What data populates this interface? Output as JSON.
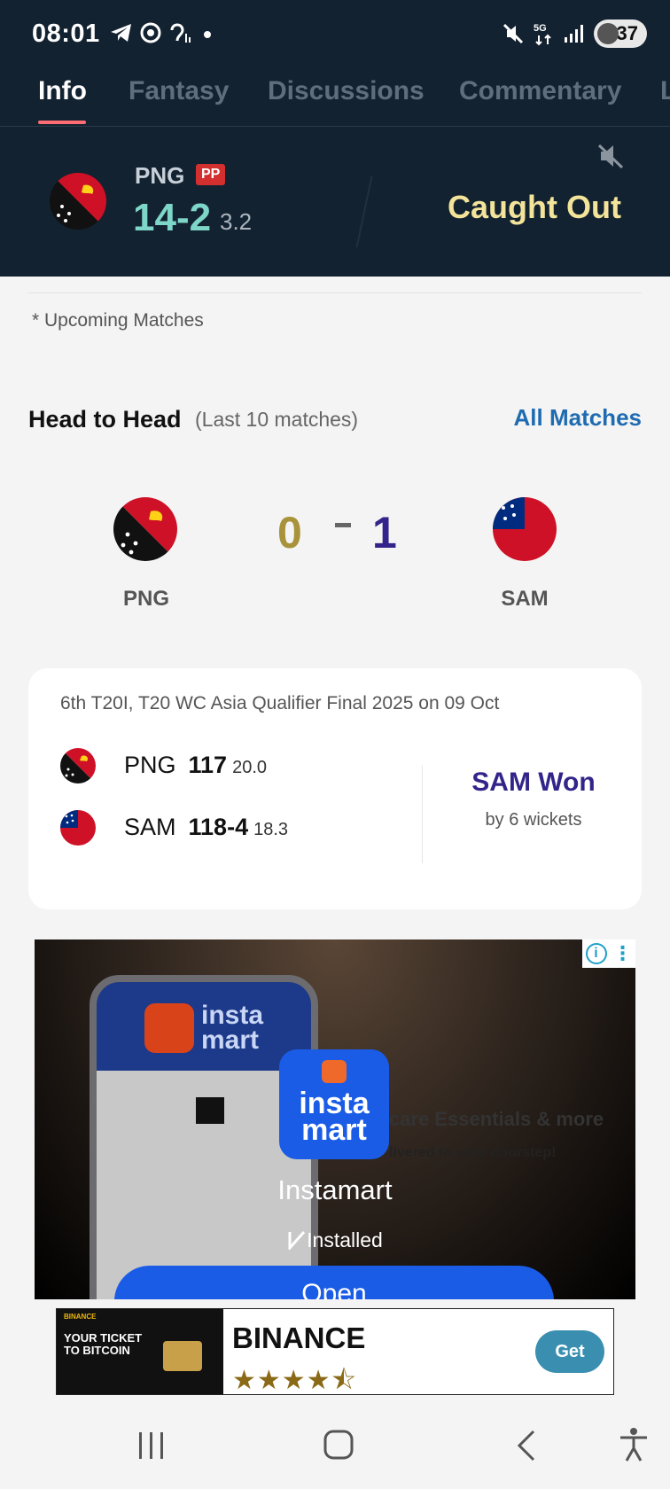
{
  "status_bar": {
    "time": "08:01",
    "left_icons": [
      "telegram-icon",
      "chrome-icon",
      "hearing-icon",
      "dot-icon"
    ],
    "right_icons": [
      "mute-icon",
      "5g-icon",
      "signal-icon"
    ],
    "battery": "37"
  },
  "tabs": [
    {
      "label": "Info",
      "active": true
    },
    {
      "label": "Fantasy",
      "active": false
    },
    {
      "label": "Discussions",
      "active": false
    },
    {
      "label": "Commentary",
      "active": false
    },
    {
      "label": "L",
      "active": false
    }
  ],
  "live_score": {
    "team": "PNG",
    "badge": "PP",
    "runs": "14-2",
    "overs": "3.2",
    "event": "Caught Out"
  },
  "upcoming_note": "* Upcoming Matches",
  "head_to_head": {
    "title": "Head to Head",
    "subtitle": "(Last 10 matches)",
    "link": "All Matches",
    "team_a": "PNG",
    "team_b": "SAM",
    "wins_a": "0",
    "wins_b": "1",
    "color_a": "#a8923a",
    "color_b": "#32248a"
  },
  "last_match": {
    "title": "6th T20I, T20 WC Asia Qualifier Final 2025 on 09 Oct",
    "rows": [
      {
        "team": "PNG",
        "score": "117",
        "overs": "20.0"
      },
      {
        "team": "SAM",
        "score": "118-4",
        "overs": "18.3"
      }
    ],
    "result": "SAM Won",
    "margin": "by 6 wickets"
  },
  "ad": {
    "app_name": "Instamart",
    "logo_text_1": "insta",
    "logo_text_2": "mart",
    "status": "Installed",
    "button": "Open",
    "bg_text_1": "care Essentials & more",
    "bg_text_2": "livered to your doorstep!"
  },
  "banner": {
    "brand_small": "BINANCE",
    "tagline_1": "YOUR TICKET",
    "tagline_2": "TO BITCOIN",
    "name": "BINANCE",
    "rating": "4.5",
    "button": "Get"
  },
  "colors": {
    "header_bg": "#132230",
    "tab_underline": "#ff6d74",
    "runs": "#7ed6c8",
    "event": "#f3e49a",
    "link": "#1f6bb2"
  }
}
